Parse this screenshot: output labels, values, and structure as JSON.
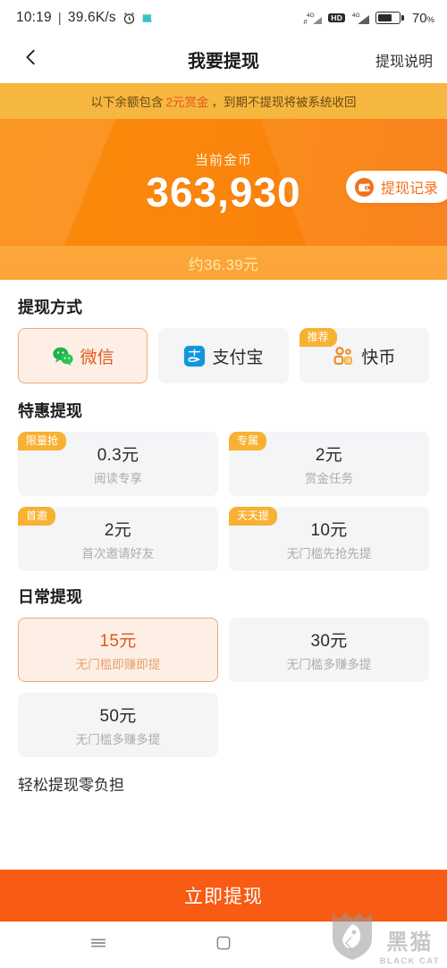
{
  "status_bar": {
    "time": "10:19",
    "separator": "|",
    "net_speed": "39.6K/s",
    "clock_icon": "alarm-clock-icon",
    "flag_icon": "flag-icon",
    "signal_label_1": "4G",
    "signal_sub_1": "↓↑",
    "hd_label": "HD",
    "signal_label_2": "4G",
    "battery_percent": "70",
    "battery_unit": "%"
  },
  "title_bar": {
    "back_icon": "back-chevron-icon",
    "title": "我要提现",
    "action_label": "提现说明"
  },
  "notice": {
    "prefix": "以下余额包含",
    "highlight": "2元赏金",
    "suffix": "，到期不提现将被系统收回"
  },
  "hero": {
    "coin_label": "当前金币",
    "coin_amount": "363,930",
    "cny_equivalent": "约36.39元",
    "record_button": {
      "label": "提现记录",
      "icon": "wallet-icon"
    }
  },
  "sections": {
    "pay_method": {
      "title": "提现方式",
      "options": [
        {
          "label": "微信",
          "icon": "wechat-icon",
          "selected": true,
          "badge": ""
        },
        {
          "label": "支付宝",
          "icon": "alipay-icon",
          "selected": false,
          "badge": ""
        },
        {
          "label": "快币",
          "icon": "kuaibi-icon",
          "selected": false,
          "badge": "推荐"
        }
      ]
    },
    "special": {
      "title": "特惠提现",
      "items": [
        {
          "value": "0.3元",
          "desc": "阅读专享",
          "badge": "限量抢",
          "selected": false
        },
        {
          "value": "2元",
          "desc": "赏金任务",
          "badge": "专属",
          "selected": false
        },
        {
          "value": "2元",
          "desc": "首次邀请好友",
          "badge": "首邀",
          "selected": false
        },
        {
          "value": "10元",
          "desc": "无门槛先抢先提",
          "badge": "天天提",
          "selected": false
        }
      ]
    },
    "daily": {
      "title": "日常提现",
      "items": [
        {
          "value": "15元",
          "desc": "无门槛即赚即提",
          "badge": "",
          "selected": true
        },
        {
          "value": "30元",
          "desc": "无门槛多赚多提",
          "badge": "",
          "selected": false
        },
        {
          "value": "50元",
          "desc": "无门槛多赚多提",
          "badge": "",
          "selected": false
        }
      ]
    },
    "foot_note": "轻松提现零负担"
  },
  "cta": {
    "label": "立即提现"
  },
  "nav_bar": {
    "menu_icon": "menu-icon",
    "home_icon": "home-square-icon",
    "back_icon": "back-chevron-icon"
  },
  "watermark": {
    "icon": "blackcat-shield-icon",
    "cn": "黑猫",
    "en": "BLACK CAT"
  },
  "colors": {
    "brand_orange": "#F97A0C",
    "cta_orange": "#F75B14",
    "notice_bg": "#F6B740",
    "badge_orange": "#F8B133",
    "selected_bg": "#FDEFE6",
    "selected_border": "#F0A878",
    "card_bg": "#F4F5F7",
    "muted_text": "#ACACAC"
  }
}
